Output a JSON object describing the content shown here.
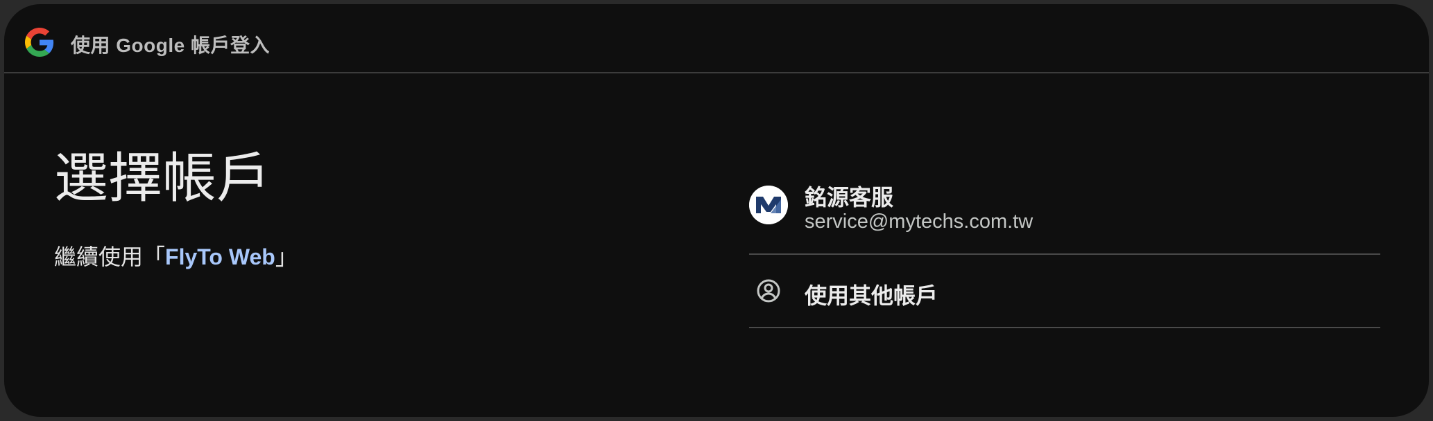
{
  "header": {
    "title": "使用 Google 帳戶登入",
    "logo_icon": "google-g-icon"
  },
  "main": {
    "title": "選擇帳戶",
    "continue_prefix": "繼續使用「",
    "app_name": "FlyTo Web",
    "continue_suffix": "」"
  },
  "accounts": [
    {
      "name": "銘源客服",
      "email": "service@mytechs.com.tw",
      "avatar_icon": "mytechs-logo-icon"
    }
  ],
  "other_account": {
    "label": "使用其他帳戶",
    "icon": "person-circle-icon"
  },
  "colors": {
    "background": "#0f0f0f",
    "link": "#a8c7fa",
    "divider": "#4a4a4a"
  }
}
